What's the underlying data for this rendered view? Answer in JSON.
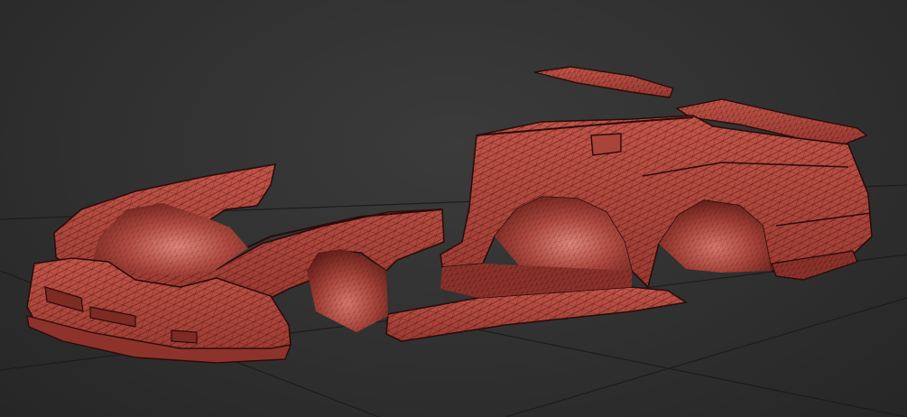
{
  "viewport": {
    "background": "#303030",
    "grid_color": "#1e1e1e",
    "model": {
      "shaded_color": "#b4483e",
      "wireframe_color": "#3a1210",
      "highlight_color": "#e0877c",
      "parts": [
        "front-bumper",
        "front-fender",
        "front-wheel-arch",
        "door-sill",
        "rear-quarter-panel",
        "rear-wheel-arch",
        "rear-bumper",
        "rear-spoiler",
        "roof-panel",
        "fuel-door"
      ]
    }
  }
}
